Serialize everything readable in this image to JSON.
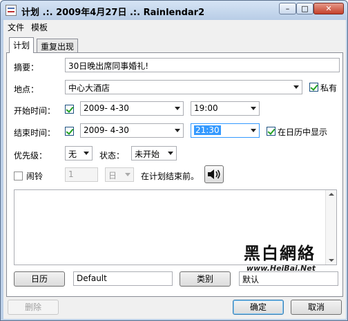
{
  "window": {
    "title": "计划 .:. 2009年4月27日 .:. Rainlendar2",
    "controls": {
      "minimize": "–",
      "maximize": "□",
      "close": "✕"
    }
  },
  "menu": {
    "items": [
      "文件",
      "模板"
    ]
  },
  "tabs": [
    {
      "label": "计划",
      "active": true
    },
    {
      "label": "重复出现",
      "active": false
    }
  ],
  "form": {
    "summary_label": "摘要：",
    "summary_value": "30日晚出席同事婚礼!",
    "location_label": "地点：",
    "location_value": "中心大酒店",
    "private_label": "私有",
    "private_checked": true,
    "start_label": "开始时间：",
    "start_enabled": true,
    "start_date": "2009-  4-30",
    "start_time": "19:00",
    "end_label": "结束时间：",
    "end_enabled": true,
    "end_date": "2009-  4-30",
    "end_time": "21:30",
    "show_in_calendar_label": "在日历中显示",
    "show_in_calendar_checked": true,
    "priority_label": "优先级：",
    "priority_value": "无",
    "status_label": "状态：",
    "status_value": "未开始",
    "alarm_label": "闹铃",
    "alarm_checked": false,
    "alarm_amount": "1",
    "alarm_unit": "日",
    "alarm_suffix": "在计划结束前。",
    "sound_icon": "speaker-icon",
    "notes_value": ""
  },
  "watermark": {
    "title": "黑白網絡",
    "url": "www.HeiBai.Net"
  },
  "bottom": {
    "calendar_button": "日历",
    "calendar_value": "Default",
    "category_button": "类别",
    "category_value": "默认"
  },
  "footer": {
    "delete_label": "删除",
    "ok_label": "确定",
    "cancel_label": "取消"
  },
  "colors": {
    "selection": "#3399ff",
    "title_bar": "#b8cde6",
    "close_button": "#c5402a"
  }
}
